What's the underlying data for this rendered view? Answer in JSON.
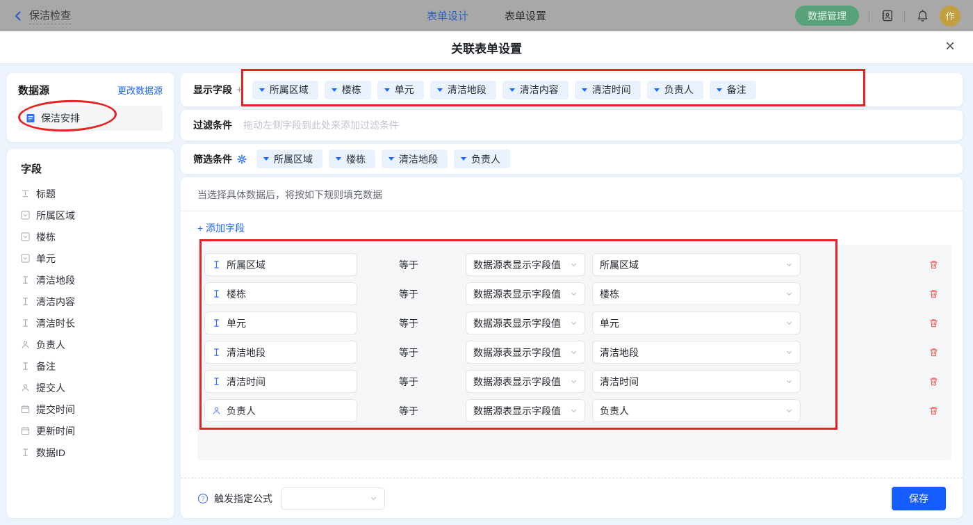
{
  "topbar": {
    "back_label": "保洁检查",
    "tabs": [
      {
        "label": "表单设计",
        "active": true
      },
      {
        "label": "表单设置",
        "active": false
      }
    ],
    "data_manage_label": "数据管理",
    "avatar_text": "作"
  },
  "modal": {
    "title": "关联表单设置",
    "close_glyph": "×"
  },
  "datasource": {
    "header": "数据源",
    "change_link": "更改数据源",
    "items": [
      {
        "label": "保洁安排",
        "icon": "document-icon"
      }
    ]
  },
  "fields_panel": {
    "header": "字段",
    "items": [
      {
        "label": "标题",
        "icon": "title-icon"
      },
      {
        "label": "所属区域",
        "icon": "select-field-icon"
      },
      {
        "label": "楼栋",
        "icon": "select-field-icon"
      },
      {
        "label": "单元",
        "icon": "select-field-icon"
      },
      {
        "label": "清洁地段",
        "icon": "text-field-icon"
      },
      {
        "label": "清洁内容",
        "icon": "text-field-icon"
      },
      {
        "label": "清洁时长",
        "icon": "text-field-icon"
      },
      {
        "label": "负责人",
        "icon": "person-icon"
      },
      {
        "label": "备注",
        "icon": "text-field-icon"
      },
      {
        "label": "提交人",
        "icon": "person-icon"
      },
      {
        "label": "提交时间",
        "icon": "calendar-icon"
      },
      {
        "label": "更新时间",
        "icon": "calendar-icon"
      },
      {
        "label": "数据ID",
        "icon": "text-field-icon"
      }
    ]
  },
  "display_fields": {
    "label": "显示字段",
    "add_glyph": "+",
    "tags": [
      "所属区域",
      "楼栋",
      "单元",
      "清洁地段",
      "清洁内容",
      "清洁时间",
      "负责人",
      "备注"
    ]
  },
  "filter": {
    "label": "过滤条件",
    "placeholder": "拖动左侧字段到此处来添加过滤条件"
  },
  "screen_filter": {
    "label": "筛选条件",
    "tags": [
      "所属区域",
      "楼栋",
      "清洁地段",
      "负责人"
    ]
  },
  "rules": {
    "note": "当选择具体数据后，将按如下规则填充数据",
    "add_field_label": "+ 添加字段",
    "equals_label": "等于",
    "source_select_value": "数据源表显示字段值",
    "rows": [
      {
        "field": "所属区域",
        "icon": "text-field-icon",
        "target": "所属区域"
      },
      {
        "field": "楼栋",
        "icon": "text-field-icon",
        "target": "楼栋"
      },
      {
        "field": "单元",
        "icon": "text-field-icon",
        "target": "单元"
      },
      {
        "field": "清洁地段",
        "icon": "text-field-icon",
        "target": "清洁地段"
      },
      {
        "field": "清洁时间",
        "icon": "text-field-icon",
        "target": "清洁时间"
      },
      {
        "field": "负责人",
        "icon": "person-icon",
        "target": "负责人"
      }
    ]
  },
  "footer": {
    "formula_label": "触发指定公式",
    "formula_select_value": "",
    "save_label": "保存"
  },
  "colors": {
    "accent_blue": "#1a66ff",
    "save_blue": "#165dff",
    "green_pill": "#57a279",
    "annotation_red": "#e62222",
    "trash_red": "#f05b5b",
    "tag_bg": "#e9f2fe"
  }
}
